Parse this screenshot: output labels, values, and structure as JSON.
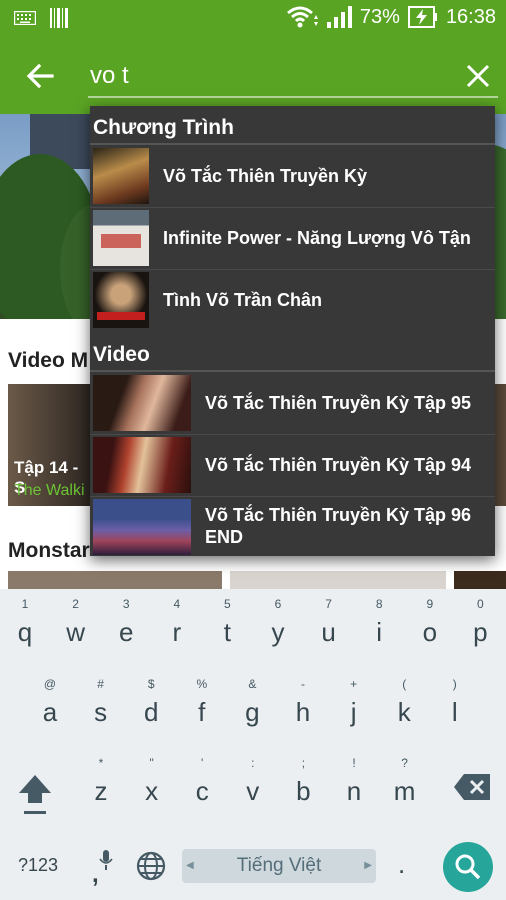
{
  "status": {
    "battery_percent": "73%",
    "time": "16:38"
  },
  "search": {
    "query": "vo t"
  },
  "background": {
    "section1_title": "Video M",
    "card1_title": "Tập 14 - S",
    "card1_show": "The Walki",
    "section2_title": "Monstar"
  },
  "dropdown": {
    "programs_header": "Chương Trình",
    "programs": [
      {
        "title": "Võ Tắc Thiên Truyền Kỳ"
      },
      {
        "title": "Infinite Power - Năng Lượng Vô Tận"
      },
      {
        "title": "Tình Võ Trần Chân"
      }
    ],
    "videos_header": "Video",
    "videos": [
      {
        "title": "Võ Tắc Thiên Truyền Kỳ Tập 95"
      },
      {
        "title": "Võ Tắc Thiên Truyền Kỳ Tập 94"
      },
      {
        "title": "Võ Tắc Thiên Truyền Kỳ Tập 96 END"
      }
    ]
  },
  "keyboard": {
    "row1": [
      {
        "key": "q",
        "hint": "1"
      },
      {
        "key": "w",
        "hint": "2"
      },
      {
        "key": "e",
        "hint": "3"
      },
      {
        "key": "r",
        "hint": "4"
      },
      {
        "key": "t",
        "hint": "5"
      },
      {
        "key": "y",
        "hint": "6"
      },
      {
        "key": "u",
        "hint": "7"
      },
      {
        "key": "i",
        "hint": "8"
      },
      {
        "key": "o",
        "hint": "9"
      },
      {
        "key": "p",
        "hint": "0"
      }
    ],
    "row2": [
      {
        "key": "a",
        "hint": "@"
      },
      {
        "key": "s",
        "hint": "#"
      },
      {
        "key": "d",
        "hint": "$"
      },
      {
        "key": "f",
        "hint": "%"
      },
      {
        "key": "g",
        "hint": "&"
      },
      {
        "key": "h",
        "hint": "-"
      },
      {
        "key": "j",
        "hint": "+"
      },
      {
        "key": "k",
        "hint": "("
      },
      {
        "key": "l",
        "hint": ")"
      }
    ],
    "row3": [
      {
        "key": "z",
        "hint": "*"
      },
      {
        "key": "x",
        "hint": "\""
      },
      {
        "key": "c",
        "hint": "'"
      },
      {
        "key": "v",
        "hint": ":"
      },
      {
        "key": "b",
        "hint": ";"
      },
      {
        "key": "n",
        "hint": "!"
      },
      {
        "key": "m",
        "hint": "?"
      }
    ],
    "symbols_label": "?123",
    "comma_label": ",",
    "space_label": "Tiếng Việt",
    "period_label": "."
  },
  "colors": {
    "accent": "#5aa424",
    "dropdown_bg": "#383838",
    "keyboard_bg": "#eceff1",
    "search_key": "#26a69a"
  }
}
